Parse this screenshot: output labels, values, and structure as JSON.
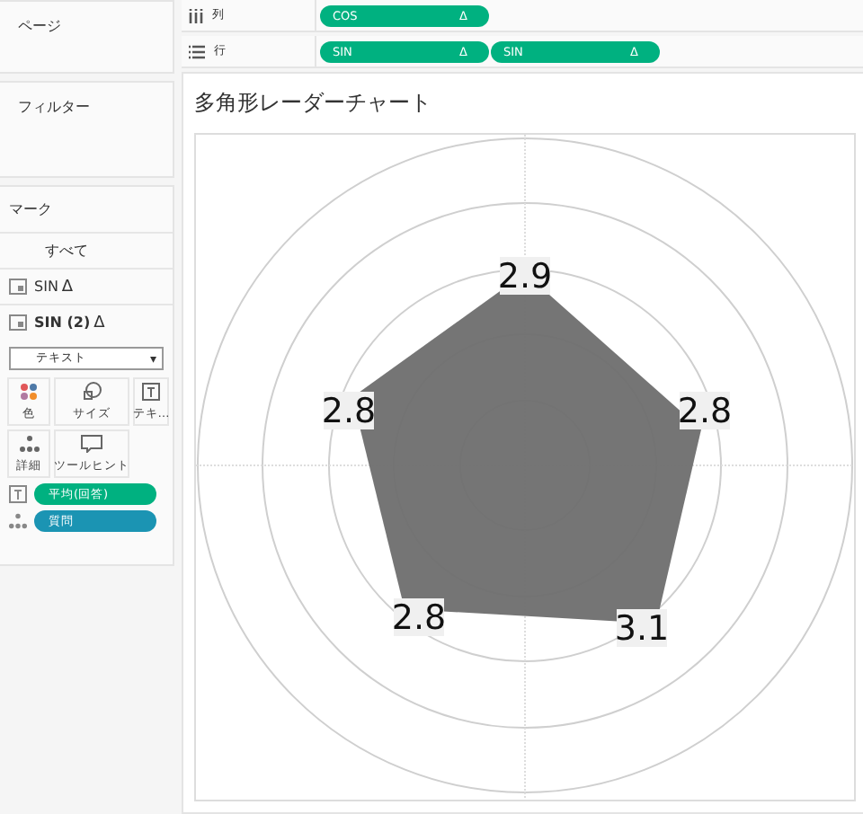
{
  "sidebar": {
    "pages": {
      "title": "ページ"
    },
    "filters": {
      "title": "フィルター"
    },
    "marks": {
      "title": "マーク",
      "layers": [
        {
          "label": "すべて",
          "bold": false,
          "icon": false
        },
        {
          "label": "SIN",
          "delta": "Δ",
          "bold": false,
          "icon": true
        },
        {
          "label": "SIN (2)",
          "delta": "Δ",
          "bold": true,
          "icon": true
        }
      ],
      "mark_type": "テキスト",
      "mark_type_caret": "▾",
      "cards": [
        {
          "label": "色",
          "kind": "color"
        },
        {
          "label": "サイズ",
          "kind": "size"
        },
        {
          "label": "テキ…",
          "kind": "text"
        },
        {
          "label": "詳細",
          "kind": "detail"
        },
        {
          "label": "ツールヒント",
          "kind": "tooltip"
        }
      ],
      "fields": [
        {
          "label": "平均(回答)",
          "kind": "text",
          "color": "#00b180"
        },
        {
          "label": "質問",
          "kind": "detail",
          "color": "#1b94b3"
        }
      ]
    }
  },
  "shelves": [
    {
      "label": "列",
      "kind": "columns",
      "pills": [
        {
          "label": "COS",
          "delta": "Δ"
        }
      ]
    },
    {
      "label": "行",
      "kind": "rows",
      "pills": [
        {
          "label": "SIN",
          "delta": "Δ"
        },
        {
          "label": "SIN",
          "delta": "Δ"
        }
      ]
    }
  ],
  "sheet": {
    "title": "多角形レーダーチャート",
    "points": [
      {
        "label": "2.9"
      },
      {
        "label": "2.8"
      },
      {
        "label": "3.1"
      },
      {
        "label": "2.8"
      },
      {
        "label": "2.8"
      }
    ]
  }
}
